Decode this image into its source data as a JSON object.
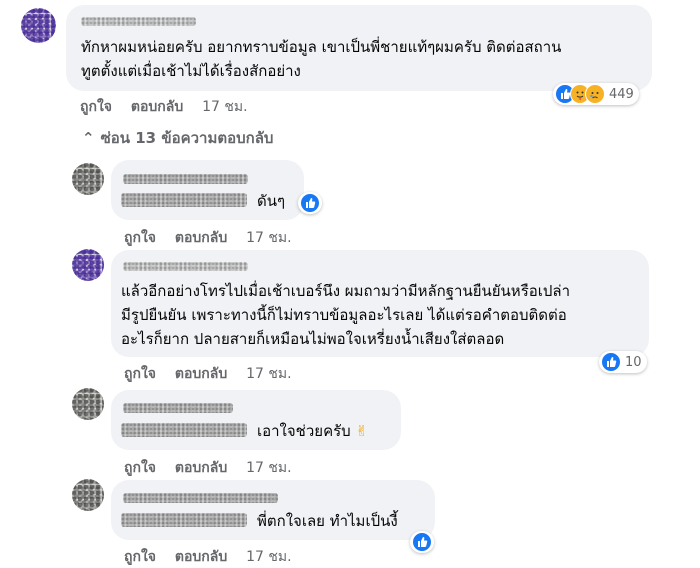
{
  "main_comment": {
    "text_line1": "ทักหาผมหน่อยครับ อยากทราบข้อมูล เขาเป็นพี่ชายแท้ๆผมครับ ติดต่อสถาน",
    "text_line2": "ทูตตั้งแต่เมื่อเช้าไม่ได้เรื่องสักอย่าง",
    "like_label": "ถูกใจ",
    "reply_label": "ตอบกลับ",
    "time": "17 ชม.",
    "reaction_count": "449",
    "reaction_icons": [
      "like-icon",
      "care-icon",
      "sad-icon"
    ]
  },
  "replies_toggle": {
    "chevron": "⌃",
    "label": "ซ่อน 13 ข้อความตอบกลับ"
  },
  "replies": [
    {
      "text": "ดันๆ",
      "like_label": "ถูกใจ",
      "reply_label": "ตอบกลับ",
      "time": "17 ชม."
    },
    {
      "line1": "แล้วอีกอย่างโทรไปเมื่อเช้าเบอร์นึง ผมถามว่ามีหลักฐานยืนยันหรือเปล่า",
      "line2": "มีรูปยืนยัน เพราะทางนี้ก็ไม่ทราบข้อมูลอะไรเลย ได้แต่รอคำตอบติดต่อ",
      "line3": "อะไรก็ยาก ปลายสายก็เหมือนไม่พอใจเหรี่ยงน้ำเสียงใส่ตลอด",
      "like_label": "ถูกใจ",
      "reply_label": "ตอบกลับ",
      "time": "17 ชม.",
      "reaction_count": "10"
    },
    {
      "text": "เอาใจช่วยครับ",
      "emoji": "✌",
      "like_label": "ถูกใจ",
      "reply_label": "ตอบกลับ",
      "time": "17 ชม."
    },
    {
      "text": "พี่ตกใจเลย ทำไมเป็นงี้",
      "like_label": "ถูกใจ",
      "reply_label": "ตอบกลับ",
      "time": "17 ชม."
    }
  ],
  "colors": {
    "bubble": "#f0f2f5",
    "secondary_text": "#65676b",
    "like_blue": "#1877f2",
    "emoji_yellow": "#f7b125"
  }
}
